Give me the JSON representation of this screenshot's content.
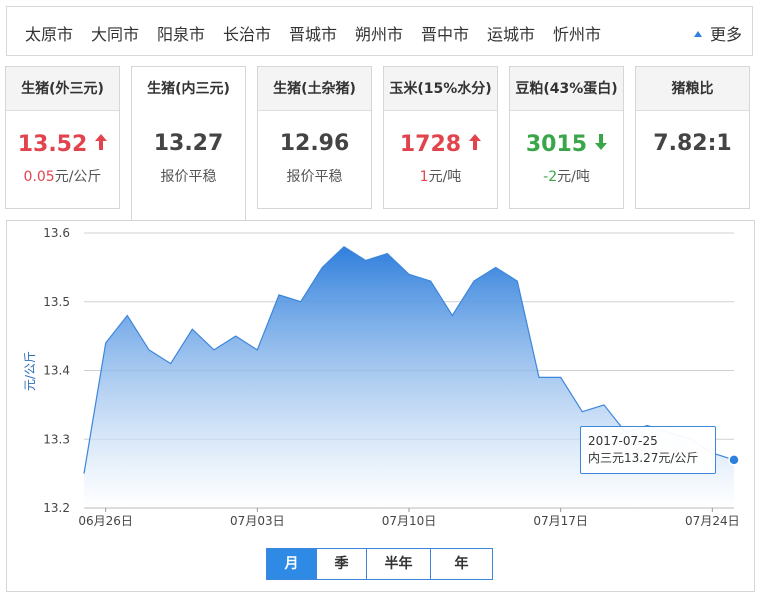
{
  "cities": [
    "太原市",
    "大同市",
    "阳泉市",
    "长治市",
    "晋城市",
    "朔州市",
    "晋中市",
    "运城市",
    "忻州市"
  ],
  "more_label": "更多",
  "cards": [
    {
      "title": "生猪(外三元)",
      "value": "13.52",
      "trend": "up",
      "change": "0.05",
      "unit": "元/公斤",
      "sub": ""
    },
    {
      "title": "生猪(内三元)",
      "value": "13.27",
      "trend": "flat",
      "change": "",
      "unit": "",
      "sub": "报价平稳"
    },
    {
      "title": "生猪(土杂猪)",
      "value": "12.96",
      "trend": "flat",
      "change": "",
      "unit": "",
      "sub": "报价平稳"
    },
    {
      "title": "玉米(15%水分)",
      "value": "1728",
      "trend": "up",
      "change": "1",
      "unit": "元/吨",
      "sub": ""
    },
    {
      "title": "豆粕(43%蛋白)",
      "value": "3015",
      "trend": "down",
      "change": "-2",
      "unit": "元/吨",
      "sub": ""
    },
    {
      "title": "猪粮比",
      "value": "7.82:1",
      "trend": "flat",
      "change": "",
      "unit": "",
      "sub": ""
    }
  ],
  "colors": {
    "up": "#e2444e",
    "down": "#3aa64a",
    "accent": "#2f8ae5",
    "line": "#3c86dc"
  },
  "chart_data": {
    "type": "area",
    "ylabel": "元/公斤",
    "ylim": [
      13.2,
      13.6
    ],
    "yticks": [
      "13.6",
      "13.5",
      "13.4",
      "13.3",
      "13.2"
    ],
    "xticks": [
      "06月26日",
      "07月03日",
      "07月10日",
      "07月17日",
      "07月24日"
    ],
    "x": [
      "06-25",
      "06-26",
      "06-27",
      "06-28",
      "06-29",
      "06-30",
      "07-01",
      "07-02",
      "07-03",
      "07-04",
      "07-05",
      "07-06",
      "07-07",
      "07-08",
      "07-09",
      "07-10",
      "07-11",
      "07-12",
      "07-13",
      "07-14",
      "07-15",
      "07-16",
      "07-17",
      "07-18",
      "07-19",
      "07-20",
      "07-21",
      "07-22",
      "07-23",
      "07-24",
      "07-25"
    ],
    "values": [
      13.25,
      13.44,
      13.48,
      13.43,
      13.41,
      13.46,
      13.43,
      13.45,
      13.43,
      13.51,
      13.5,
      13.55,
      13.58,
      13.56,
      13.57,
      13.54,
      13.53,
      13.48,
      13.53,
      13.55,
      13.53,
      13.39,
      13.39,
      13.34,
      13.35,
      13.31,
      13.32,
      13.31,
      13.3,
      13.28,
      13.27
    ],
    "grid": true,
    "tooltip": {
      "date": "2017-07-25",
      "text": "内三元13.27元/公斤"
    }
  },
  "tabs": [
    "月",
    "季",
    "半年",
    "年"
  ],
  "active_tab": "月"
}
